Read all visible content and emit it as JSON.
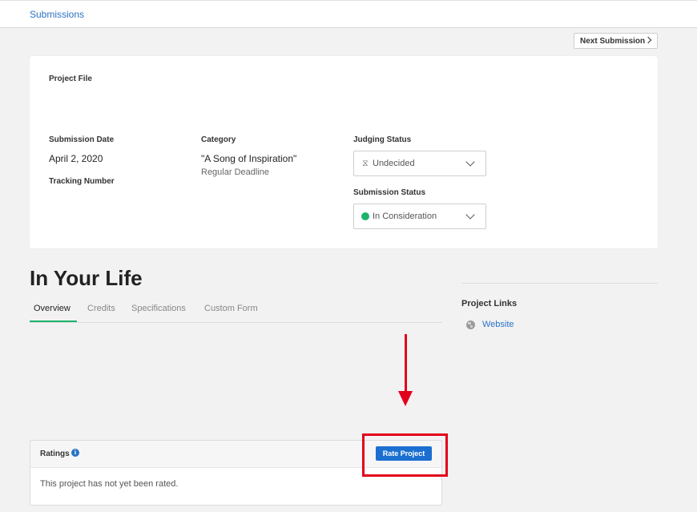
{
  "breadcrumb": {
    "label": "Submissions"
  },
  "next_submission": {
    "label": "Next Submission"
  },
  "project_card": {
    "project_file_label": "Project File",
    "submission_date_label": "Submission Date",
    "submission_date_value": "April 2, 2020",
    "tracking_number_label": "Tracking Number",
    "category_label": "Category",
    "category_value": "\"A Song of Inspiration\"",
    "category_deadline": "Regular Deadline",
    "judging_status_label": "Judging Status",
    "judging_status_value": "Undecided",
    "submission_status_label": "Submission Status",
    "submission_status_value": "In Consideration"
  },
  "project_title": "In Your Life",
  "tabs": [
    {
      "label": "Overview"
    },
    {
      "label": "Credits"
    },
    {
      "label": "Specifications"
    },
    {
      "label": "Custom Form"
    }
  ],
  "project_links": {
    "heading": "Project Links",
    "website_label": "Website"
  },
  "ratings": {
    "title": "Ratings",
    "info_glyph": "i",
    "empty_text": "This project has not yet been rated.",
    "rate_button_label": "Rate Project"
  },
  "colors": {
    "accent_blue": "#1b6fd1",
    "link_blue": "#2a73c5",
    "status_green": "#1db36b",
    "annotation_red": "#e3001b"
  },
  "icons": [
    "hourglass-icon",
    "status-dot-icon",
    "chevron-down-icon",
    "chevron-right-icon",
    "globe-icon",
    "info-icon"
  ]
}
